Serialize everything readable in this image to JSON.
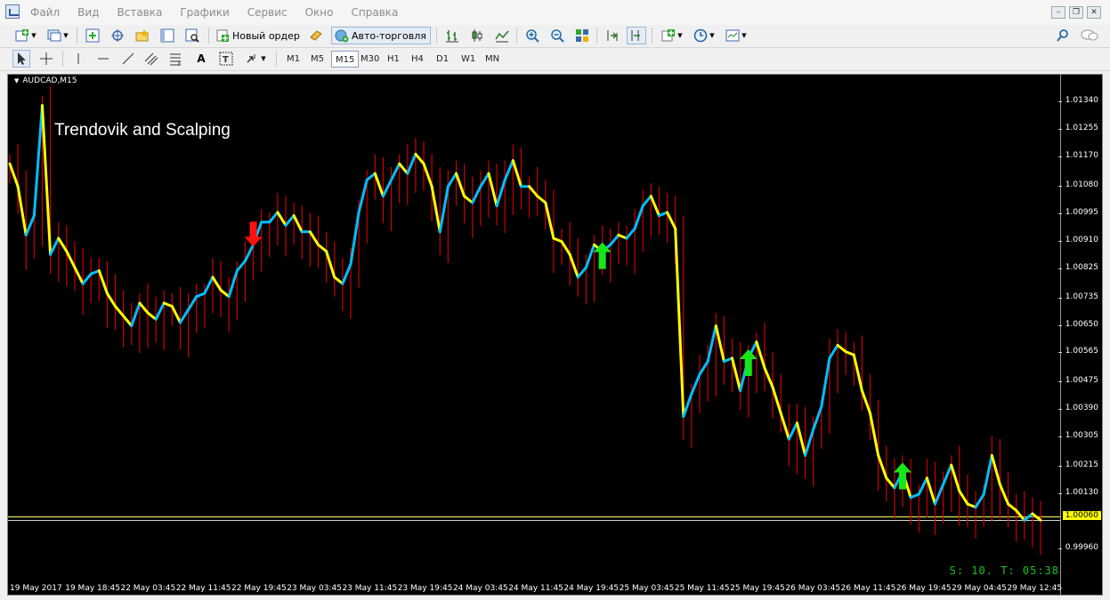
{
  "menu": {
    "items": [
      "Файл",
      "Вид",
      "Вставка",
      "Графики",
      "Сервис",
      "Окно",
      "Справка"
    ]
  },
  "toolbar1": {
    "new_order_label": "Новый ордер",
    "auto_trading_label": "Авто-торговля"
  },
  "toolbar2": {
    "timeframes": [
      "M1",
      "M5",
      "M15",
      "M30",
      "H1",
      "H4",
      "D1",
      "W1",
      "MN"
    ],
    "active_timeframe": "M15"
  },
  "chart": {
    "title": "AUDCAD,M15",
    "overlay_text": "Trendovik and Scalping",
    "stats_text": "S: 10. T: 05:38",
    "current_price_label": "1.00060",
    "colors": {
      "up": "#00bfff",
      "down": "#ffff00",
      "wick": "#cc0000",
      "buy_arrow": "#19e619",
      "sell_arrow": "#ff1010",
      "price_line": "#ffff66"
    }
  },
  "chart_data": {
    "type": "line",
    "series": [
      {
        "values": [
          1.0115,
          1.0108,
          1.0093,
          1.0099,
          1.0133,
          1.0087,
          1.0092,
          1.0088,
          1.0083,
          1.0078,
          1.0081,
          1.0082,
          1.0075,
          1.0071,
          1.0068,
          1.0065,
          1.0072,
          1.0069,
          1.0067,
          1.0072,
          1.0071,
          1.0066,
          1.007,
          1.0074,
          1.0075,
          1.008,
          1.0076,
          1.0074,
          1.0082,
          1.0085,
          1.009,
          1.0097,
          1.0097,
          1.01,
          1.0096,
          1.0099,
          1.0094,
          1.0094,
          1.009,
          1.0088,
          1.008,
          1.0078,
          1.0084,
          1.01,
          1.011,
          1.0112,
          1.0105,
          1.011,
          1.0115,
          1.0112,
          1.0118,
          1.0115,
          1.0108,
          1.0094,
          1.0108,
          1.0112,
          1.0105,
          1.0103,
          1.0108,
          1.0112,
          1.0102,
          1.011,
          1.0116,
          1.0108,
          1.0108,
          1.0105,
          1.0103,
          1.0092,
          1.0091,
          1.0087,
          1.008,
          1.0083,
          1.009,
          1.0088,
          1.009,
          1.0093,
          1.0092,
          1.0095,
          1.0102,
          1.0105,
          1.0099,
          1.01,
          1.0095,
          1.0037,
          1.0044,
          1.005,
          1.0054,
          1.0065,
          1.0054,
          1.0055,
          1.0045,
          1.0055,
          1.006,
          1.0052,
          1.0046,
          1.0038,
          1.003,
          1.0035,
          1.0025,
          1.0033,
          1.004,
          1.0055,
          1.0059,
          1.0057,
          1.0056,
          1.0045,
          1.0038,
          1.0025,
          1.0018,
          1.0015,
          1.002,
          1.0012,
          1.0013,
          1.0018,
          1.001,
          1.0016,
          1.0022,
          1.0014,
          1.001,
          1.0009,
          1.0013,
          1.0025,
          1.0016,
          1.001,
          1.0008,
          1.0005,
          1.0007,
          1.0005
        ]
      }
    ],
    "yticks": [
      "1.01340",
      "1.01255",
      "1.01170",
      "1.01080",
      "1.00995",
      "1.00910",
      "1.00825",
      "1.00735",
      "1.00650",
      "1.00565",
      "1.00475",
      "1.00390",
      "1.00305",
      "1.00215",
      "1.00130",
      "1.00060",
      "0.99960"
    ],
    "ylim": [
      0.9996,
      1.0134
    ],
    "xticks": [
      "19 May 2017",
      "19 May 18:45",
      "22 May 03:45",
      "22 May 11:45",
      "22 May 19:45",
      "23 May 03:45",
      "23 May 11:45",
      "23 May 19:45",
      "24 May 03:45",
      "24 May 11:45",
      "24 May 19:45",
      "25 May 03:45",
      "25 May 11:45",
      "25 May 19:45",
      "26 May 03:45",
      "26 May 11:45",
      "26 May 19:45",
      "29 May 04:45",
      "29 May 12:45"
    ],
    "current_price": 1.0006,
    "signals": [
      {
        "type": "sell",
        "index": 30
      },
      {
        "type": "buy",
        "index": 73
      },
      {
        "type": "buy",
        "index": 91
      },
      {
        "type": "buy",
        "index": 110
      }
    ]
  }
}
